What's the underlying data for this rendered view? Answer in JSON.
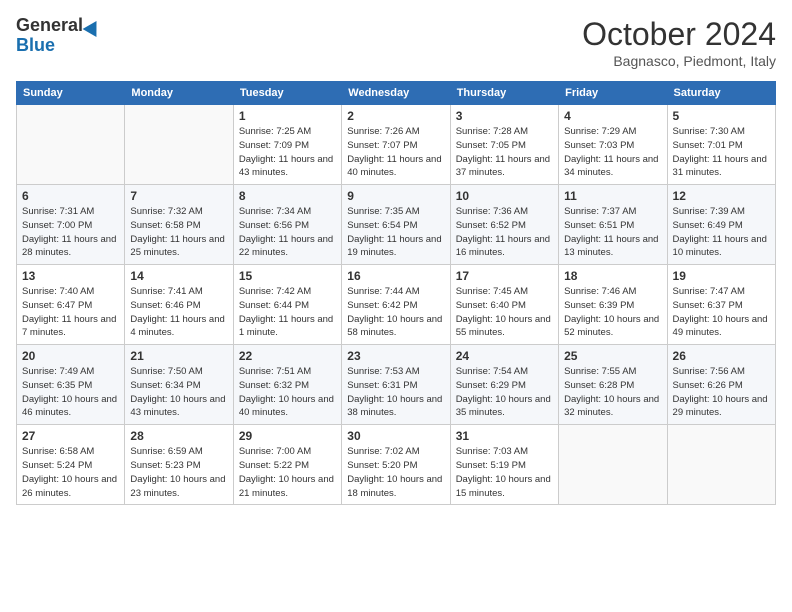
{
  "header": {
    "logo_general": "General",
    "logo_blue": "Blue",
    "title": "October 2024",
    "location": "Bagnasco, Piedmont, Italy"
  },
  "days_of_week": [
    "Sunday",
    "Monday",
    "Tuesday",
    "Wednesday",
    "Thursday",
    "Friday",
    "Saturday"
  ],
  "weeks": [
    [
      {
        "day": "",
        "info": ""
      },
      {
        "day": "",
        "info": ""
      },
      {
        "day": "1",
        "info": "Sunrise: 7:25 AM\nSunset: 7:09 PM\nDaylight: 11 hours and 43 minutes."
      },
      {
        "day": "2",
        "info": "Sunrise: 7:26 AM\nSunset: 7:07 PM\nDaylight: 11 hours and 40 minutes."
      },
      {
        "day": "3",
        "info": "Sunrise: 7:28 AM\nSunset: 7:05 PM\nDaylight: 11 hours and 37 minutes."
      },
      {
        "day": "4",
        "info": "Sunrise: 7:29 AM\nSunset: 7:03 PM\nDaylight: 11 hours and 34 minutes."
      },
      {
        "day": "5",
        "info": "Sunrise: 7:30 AM\nSunset: 7:01 PM\nDaylight: 11 hours and 31 minutes."
      }
    ],
    [
      {
        "day": "6",
        "info": "Sunrise: 7:31 AM\nSunset: 7:00 PM\nDaylight: 11 hours and 28 minutes."
      },
      {
        "day": "7",
        "info": "Sunrise: 7:32 AM\nSunset: 6:58 PM\nDaylight: 11 hours and 25 minutes."
      },
      {
        "day": "8",
        "info": "Sunrise: 7:34 AM\nSunset: 6:56 PM\nDaylight: 11 hours and 22 minutes."
      },
      {
        "day": "9",
        "info": "Sunrise: 7:35 AM\nSunset: 6:54 PM\nDaylight: 11 hours and 19 minutes."
      },
      {
        "day": "10",
        "info": "Sunrise: 7:36 AM\nSunset: 6:52 PM\nDaylight: 11 hours and 16 minutes."
      },
      {
        "day": "11",
        "info": "Sunrise: 7:37 AM\nSunset: 6:51 PM\nDaylight: 11 hours and 13 minutes."
      },
      {
        "day": "12",
        "info": "Sunrise: 7:39 AM\nSunset: 6:49 PM\nDaylight: 11 hours and 10 minutes."
      }
    ],
    [
      {
        "day": "13",
        "info": "Sunrise: 7:40 AM\nSunset: 6:47 PM\nDaylight: 11 hours and 7 minutes."
      },
      {
        "day": "14",
        "info": "Sunrise: 7:41 AM\nSunset: 6:46 PM\nDaylight: 11 hours and 4 minutes."
      },
      {
        "day": "15",
        "info": "Sunrise: 7:42 AM\nSunset: 6:44 PM\nDaylight: 11 hours and 1 minute."
      },
      {
        "day": "16",
        "info": "Sunrise: 7:44 AM\nSunset: 6:42 PM\nDaylight: 10 hours and 58 minutes."
      },
      {
        "day": "17",
        "info": "Sunrise: 7:45 AM\nSunset: 6:40 PM\nDaylight: 10 hours and 55 minutes."
      },
      {
        "day": "18",
        "info": "Sunrise: 7:46 AM\nSunset: 6:39 PM\nDaylight: 10 hours and 52 minutes."
      },
      {
        "day": "19",
        "info": "Sunrise: 7:47 AM\nSunset: 6:37 PM\nDaylight: 10 hours and 49 minutes."
      }
    ],
    [
      {
        "day": "20",
        "info": "Sunrise: 7:49 AM\nSunset: 6:35 PM\nDaylight: 10 hours and 46 minutes."
      },
      {
        "day": "21",
        "info": "Sunrise: 7:50 AM\nSunset: 6:34 PM\nDaylight: 10 hours and 43 minutes."
      },
      {
        "day": "22",
        "info": "Sunrise: 7:51 AM\nSunset: 6:32 PM\nDaylight: 10 hours and 40 minutes."
      },
      {
        "day": "23",
        "info": "Sunrise: 7:53 AM\nSunset: 6:31 PM\nDaylight: 10 hours and 38 minutes."
      },
      {
        "day": "24",
        "info": "Sunrise: 7:54 AM\nSunset: 6:29 PM\nDaylight: 10 hours and 35 minutes."
      },
      {
        "day": "25",
        "info": "Sunrise: 7:55 AM\nSunset: 6:28 PM\nDaylight: 10 hours and 32 minutes."
      },
      {
        "day": "26",
        "info": "Sunrise: 7:56 AM\nSunset: 6:26 PM\nDaylight: 10 hours and 29 minutes."
      }
    ],
    [
      {
        "day": "27",
        "info": "Sunrise: 6:58 AM\nSunset: 5:24 PM\nDaylight: 10 hours and 26 minutes."
      },
      {
        "day": "28",
        "info": "Sunrise: 6:59 AM\nSunset: 5:23 PM\nDaylight: 10 hours and 23 minutes."
      },
      {
        "day": "29",
        "info": "Sunrise: 7:00 AM\nSunset: 5:22 PM\nDaylight: 10 hours and 21 minutes."
      },
      {
        "day": "30",
        "info": "Sunrise: 7:02 AM\nSunset: 5:20 PM\nDaylight: 10 hours and 18 minutes."
      },
      {
        "day": "31",
        "info": "Sunrise: 7:03 AM\nSunset: 5:19 PM\nDaylight: 10 hours and 15 minutes."
      },
      {
        "day": "",
        "info": ""
      },
      {
        "day": "",
        "info": ""
      }
    ]
  ]
}
